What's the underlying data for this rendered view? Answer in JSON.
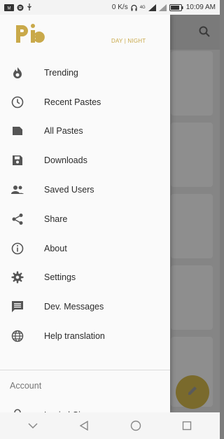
{
  "status_bar": {
    "speed": "0 K/s",
    "network_type": "4G",
    "time": "10:09 AM"
  },
  "header": {
    "day_night_label": "DAY | NIGHT"
  },
  "menu": {
    "items": [
      {
        "label": "Trending",
        "icon": "flame-icon"
      },
      {
        "label": "Recent Pastes",
        "icon": "clock-icon"
      },
      {
        "label": "All Pastes",
        "icon": "document-icon"
      },
      {
        "label": "Downloads",
        "icon": "save-icon"
      },
      {
        "label": "Saved Users",
        "icon": "users-icon"
      },
      {
        "label": "Share",
        "icon": "share-icon"
      },
      {
        "label": "About",
        "icon": "info-icon"
      },
      {
        "label": "Settings",
        "icon": "gear-icon"
      },
      {
        "label": "Dev. Messages",
        "icon": "message-icon"
      },
      {
        "label": "Help translation",
        "icon": "globe-icon"
      }
    ]
  },
  "account": {
    "title": "Account",
    "login_label": "Login | Signup"
  },
  "colors": {
    "accent": "#c9a94a",
    "icon": "#555555"
  }
}
